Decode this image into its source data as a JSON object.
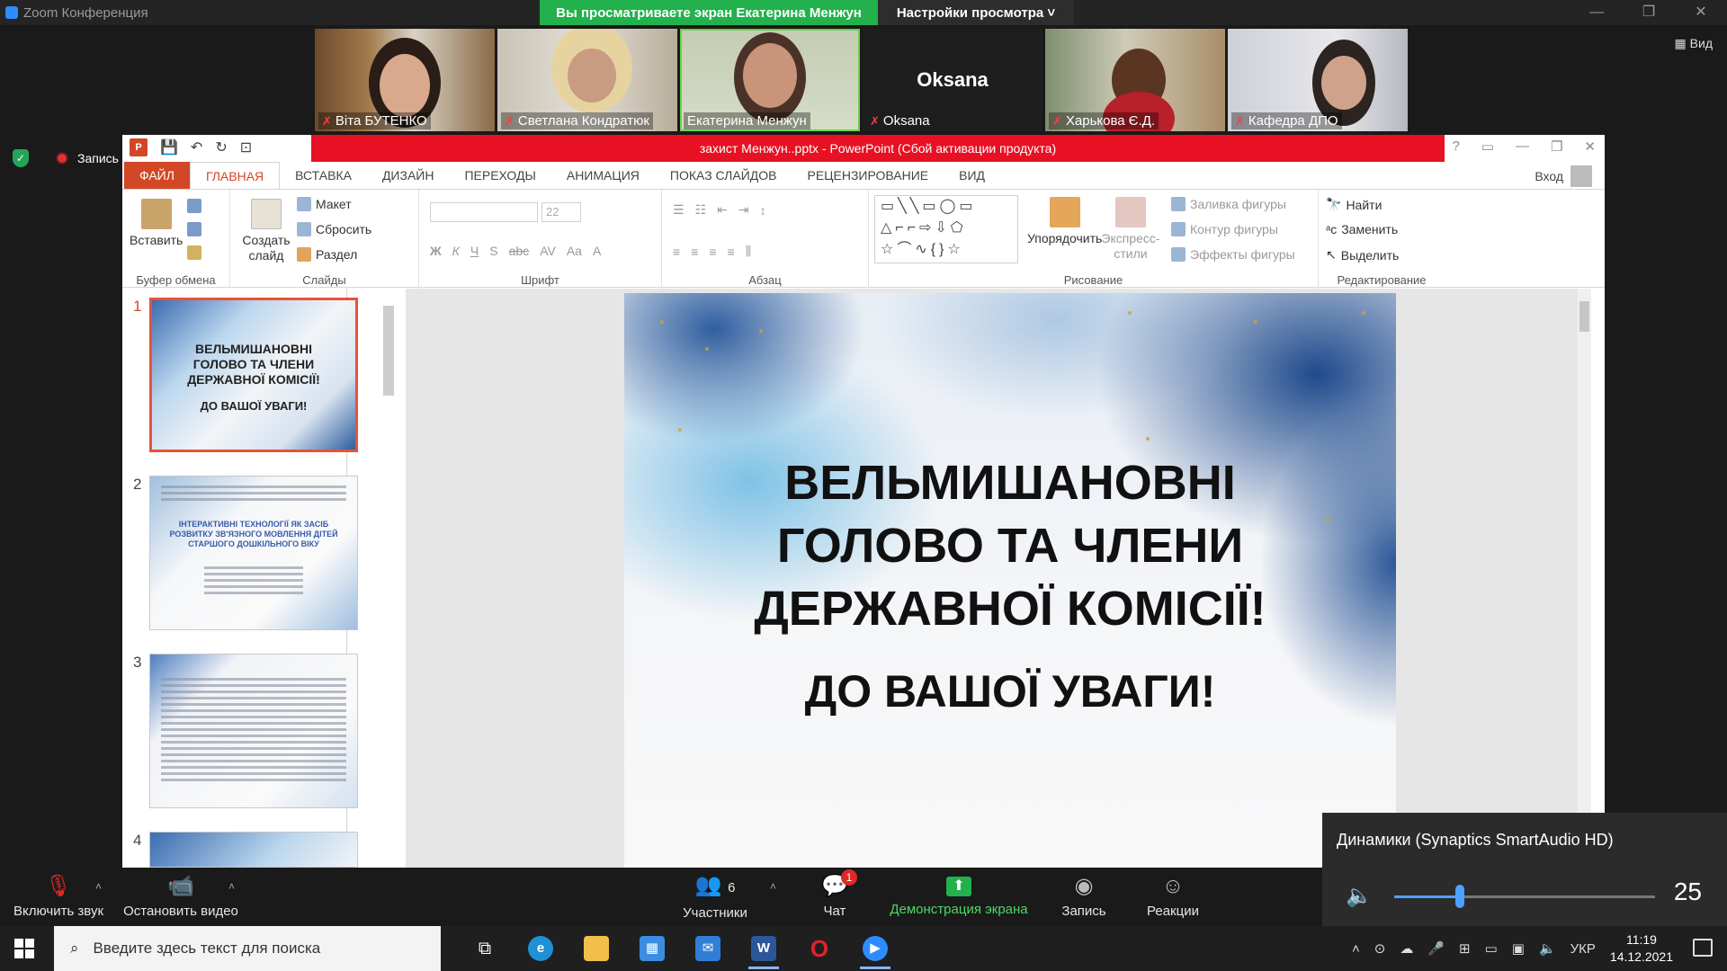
{
  "zoom": {
    "title": "Zoom Конференция",
    "share_banner": "Вы просматриваете экран Екатерина Менжун",
    "view_settings": "Настройки просмотра ˅",
    "view_button": "Вид",
    "record_indicator": "Запись",
    "participants": [
      {
        "name": "Віта БУТЕНКО",
        "muted": true
      },
      {
        "name": "Светлана Кондратюк",
        "muted": true
      },
      {
        "name": "Екатерина Менжун",
        "muted": false,
        "active": true
      },
      {
        "name": "Oksana",
        "muted": true,
        "video": false
      },
      {
        "name": "Харькова Є.Д.",
        "muted": true
      },
      {
        "name": "Кафедра ДПО",
        "muted": true
      }
    ],
    "controls": {
      "unmute": "Включить звук",
      "stop_video": "Остановить видео",
      "participants": "Участники",
      "participants_count": "6",
      "chat": "Чат",
      "chat_badge": "1",
      "share_screen": "Демонстрация экрана",
      "record": "Запись",
      "reactions": "Реакции"
    },
    "speaker_popup": {
      "device": "Динамики (Synaptics SmartAudio HD)",
      "volume": "25",
      "volume_fraction": 0.25
    }
  },
  "powerpoint": {
    "title": "захист Менжун..pptx -  PowerPoint (Сбой активации продукта)",
    "signin": "Вход",
    "tabs": [
      "ФАЙЛ",
      "ГЛАВНАЯ",
      "ВСТАВКА",
      "ДИЗАЙН",
      "ПЕРЕХОДЫ",
      "АНИМАЦИЯ",
      "ПОКАЗ СЛАЙДОВ",
      "РЕЦЕНЗИРОВАНИЕ",
      "ВИД"
    ],
    "ribbon": {
      "clipboard": {
        "paste": "Вставить",
        "label": "Буфер обмена"
      },
      "slides": {
        "new_slide": "Создать слайд",
        "layout": "Макет",
        "reset": "Сбросить",
        "section": "Раздел",
        "label": "Слайды"
      },
      "font": {
        "size": "22",
        "label": "Шрифт",
        "bold": "Ж",
        "italic": "К",
        "underline": "Ч",
        "shadow": "S",
        "strike": "abc",
        "spacing": "AV",
        "case": "Aa",
        "color": "A"
      },
      "paragraph": {
        "label": "Абзац"
      },
      "drawing": {
        "arrange": "Упорядочить",
        "quick_styles": "Экспресс-стили",
        "fill": "Заливка фигуры",
        "outline": "Контур фигуры",
        "effects": "Эффекты фигуры",
        "label": "Рисование"
      },
      "editing": {
        "find": "Найти",
        "replace": "Заменить",
        "select": "Выделить",
        "label": "Редактирование"
      }
    },
    "thumbnails": [
      {
        "num": "1",
        "line1": "ВЕЛЬМИШАНОВНІ",
        "line2": "ГОЛОВО ТА ЧЛЕНИ",
        "line3": "ДЕРЖАВНОЇ КОМІСІЇ!",
        "line4": "ДО ВАШОЇ УВАГИ!"
      },
      {
        "num": "2",
        "heading": "ІНТЕРАКТИВНІ ТЕХНОЛОГІЇ ЯК ЗАСІБ РОЗВИТКУ ЗВ'ЯЗНОГО МОВЛЕННЯ ДІТЕЙ СТАРШОГО ДОШКІЛЬНОГО ВІКУ"
      },
      {
        "num": "3"
      },
      {
        "num": "4"
      }
    ],
    "slide": {
      "line1": "ВЕЛЬМИШАНОВНІ",
      "line2": "ГОЛОВО ТА ЧЛЕНИ",
      "line3": "ДЕРЖАВНОЇ КОМІСІЇ!",
      "line4": "ДО ВАШОЇ УВАГИ!"
    }
  },
  "taskbar": {
    "search_placeholder": "Введите здесь текст для поиска",
    "language": "УКР",
    "time": "11:19",
    "date": "14.12.2021"
  }
}
